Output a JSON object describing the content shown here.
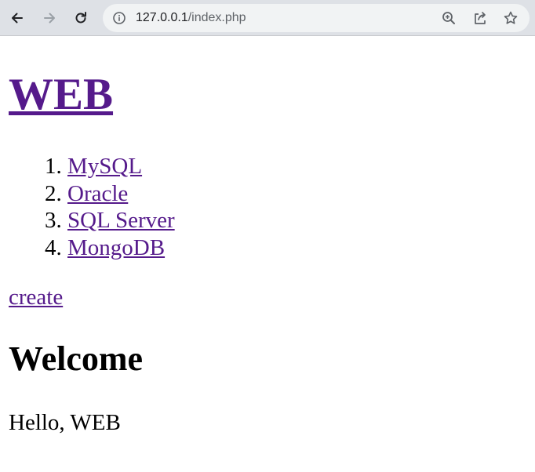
{
  "browser": {
    "url_host": "127.0.0.1",
    "url_path": "/index.php",
    "icons": {
      "back": "back-arrow-icon",
      "forward": "forward-arrow-icon",
      "reload": "reload-icon",
      "info": "info-icon",
      "zoom": "zoom-icon",
      "share": "share-icon",
      "bookmark": "star-icon"
    }
  },
  "page": {
    "title": "WEB",
    "list": [
      {
        "num": "1.",
        "label": "MySQL"
      },
      {
        "num": "2.",
        "label": "Oracle"
      },
      {
        "num": "3.",
        "label": "SQL Server"
      },
      {
        "num": "4.",
        "label": "MongoDB"
      }
    ],
    "create_label": "create",
    "heading": "Welcome",
    "body": "Hello, WEB"
  },
  "colors": {
    "link_visited": "#551a8b",
    "toolbar_bg": "#dee1e6",
    "omnibox_bg": "#f1f3f4"
  }
}
